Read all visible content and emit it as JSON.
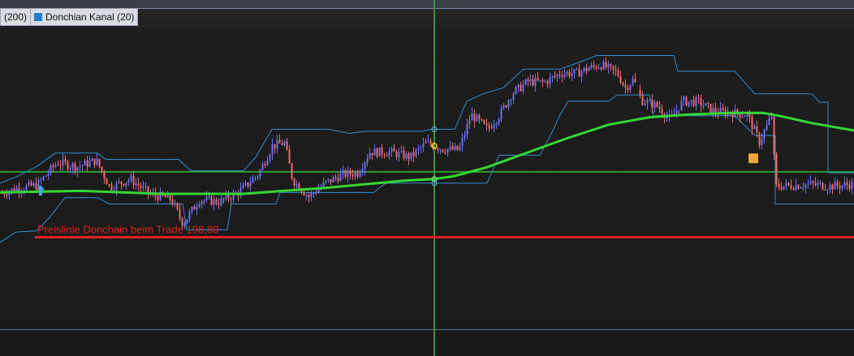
{
  "legend": {
    "ma_period": "(200)",
    "donchian_label": "Donchian Kanal (20)",
    "donchian_color": "#1e7fd0"
  },
  "colors": {
    "up_candle": "#6f6ff5",
    "down_candle": "#f06a6a",
    "ma_line": "#35d635",
    "donchian": "#2f8fd6",
    "level_line": "#e32020",
    "cursor": "#2e9a2e",
    "hline": "#2e9a2e"
  },
  "annotation": {
    "text": "Preislinie Donchain beim Trade 198,80",
    "price": 198.8
  },
  "chart_data": {
    "type": "candlestick",
    "title": "",
    "ylim": [
      187.35,
      220.87
    ],
    "xlim": [
      0,
      1052
    ],
    "price_anchors": [
      [
        0,
        203.0
      ],
      [
        20,
        203.5
      ],
      [
        45,
        203.8
      ],
      [
        70,
        206.0
      ],
      [
        95,
        205.6
      ],
      [
        118,
        206.2
      ],
      [
        135,
        203.6
      ],
      [
        160,
        204.4
      ],
      [
        185,
        202.9
      ],
      [
        210,
        202.5
      ],
      [
        225,
        200.1
      ],
      [
        245,
        202.4
      ],
      [
        270,
        202.2
      ],
      [
        295,
        203.2
      ],
      [
        318,
        204.9
      ],
      [
        335,
        207.6
      ],
      [
        350,
        207.9
      ],
      [
        360,
        204.3
      ],
      [
        380,
        202.7
      ],
      [
        400,
        204.0
      ],
      [
        420,
        204.8
      ],
      [
        440,
        205.0
      ],
      [
        455,
        207.0
      ],
      [
        480,
        207.0
      ],
      [
        505,
        206.5
      ],
      [
        525,
        207.9
      ],
      [
        545,
        207.3
      ],
      [
        565,
        207.2
      ],
      [
        580,
        210.6
      ],
      [
        600,
        209.2
      ],
      [
        615,
        210.6
      ],
      [
        630,
        212.6
      ],
      [
        650,
        213.8
      ],
      [
        670,
        213.7
      ],
      [
        690,
        214.6
      ],
      [
        710,
        214.6
      ],
      [
        725,
        215.1
      ],
      [
        740,
        215.4
      ],
      [
        760,
        214.6
      ],
      [
        770,
        213.2
      ],
      [
        780,
        214.0
      ],
      [
        790,
        212.0
      ],
      [
        810,
        211.4
      ],
      [
        825,
        210.1
      ],
      [
        840,
        211.9
      ],
      [
        860,
        211.8
      ],
      [
        880,
        210.9
      ],
      [
        900,
        210.8
      ],
      [
        920,
        210.6
      ],
      [
        935,
        208.0
      ],
      [
        950,
        210.5
      ],
      [
        955,
        203.7
      ],
      [
        980,
        203.8
      ],
      [
        1000,
        203.9
      ],
      [
        1020,
        203.7
      ],
      [
        1052,
        203.9
      ]
    ],
    "moving_average": {
      "name": "(200)",
      "points": [
        [
          0,
          203.12
        ],
        [
          100,
          203.26
        ],
        [
          200,
          202.98
        ],
        [
          300,
          202.98
        ],
        [
          400,
          203.55
        ],
        [
          500,
          204.26
        ],
        [
          535,
          204.4
        ],
        [
          560,
          204.69
        ],
        [
          600,
          205.54
        ],
        [
          650,
          206.96
        ],
        [
          700,
          208.37
        ],
        [
          750,
          209.64
        ],
        [
          800,
          210.35
        ],
        [
          850,
          210.63
        ],
        [
          900,
          210.77
        ],
        [
          940,
          210.77
        ],
        [
          960,
          210.49
        ],
        [
          1000,
          209.79
        ],
        [
          1052,
          209.08
        ]
      ]
    },
    "donchian_upper": [
      [
        0,
        204.0
      ],
      [
        20,
        204.6
      ],
      [
        45,
        205.6
      ],
      [
        68,
        206.9
      ],
      [
        120,
        206.9
      ],
      [
        130,
        206.3
      ],
      [
        220,
        206.3
      ],
      [
        235,
        205.2
      ],
      [
        300,
        205.2
      ],
      [
        315,
        206.5
      ],
      [
        335,
        209.2
      ],
      [
        405,
        209.2
      ],
      [
        430,
        208.8
      ],
      [
        450,
        209.0
      ],
      [
        520,
        209.0
      ],
      [
        530,
        209.2
      ],
      [
        560,
        209.2
      ],
      [
        575,
        211.9
      ],
      [
        595,
        212.6
      ],
      [
        620,
        213.2
      ],
      [
        645,
        215.0
      ],
      [
        690,
        215.0
      ],
      [
        705,
        215.4
      ],
      [
        735,
        216.3
      ],
      [
        830,
        216.3
      ],
      [
        835,
        214.8
      ],
      [
        905,
        214.8
      ],
      [
        930,
        212.6
      ],
      [
        1000,
        212.6
      ],
      [
        1010,
        211.8
      ],
      [
        1020,
        211.8
      ],
      [
        1020,
        205.0
      ],
      [
        1052,
        205.0
      ]
    ],
    "donchian_lower": [
      [
        0,
        198.3
      ],
      [
        20,
        199.3
      ],
      [
        45,
        199.4
      ],
      [
        60,
        200.6
      ],
      [
        80,
        202.6
      ],
      [
        120,
        202.6
      ],
      [
        135,
        202.0
      ],
      [
        225,
        202.0
      ],
      [
        230,
        199.5
      ],
      [
        280,
        199.5
      ],
      [
        285,
        202.0
      ],
      [
        340,
        202.0
      ],
      [
        345,
        203.1
      ],
      [
        460,
        203.1
      ],
      [
        475,
        204.0
      ],
      [
        600,
        204.0
      ],
      [
        615,
        206.7
      ],
      [
        665,
        206.7
      ],
      [
        680,
        208.9
      ],
      [
        690,
        210.6
      ],
      [
        700,
        211.9
      ],
      [
        750,
        211.9
      ],
      [
        760,
        212.5
      ],
      [
        800,
        212.5
      ],
      [
        805,
        210.5
      ],
      [
        905,
        210.5
      ],
      [
        930,
        208.6
      ],
      [
        955,
        208.6
      ],
      [
        955,
        202.0
      ],
      [
        1052,
        202.0
      ]
    ],
    "horizontal_lines": [
      {
        "label": "hline-upper",
        "price": 205.1
      },
      {
        "label": "hline-lower",
        "price": 189.9
      }
    ],
    "crosshair_x": 535,
    "markers": [
      {
        "type": "signal-square",
        "x": 928,
        "price": 206.4
      },
      {
        "type": "entry-arrow",
        "x": 50,
        "price": 203.2
      }
    ]
  }
}
